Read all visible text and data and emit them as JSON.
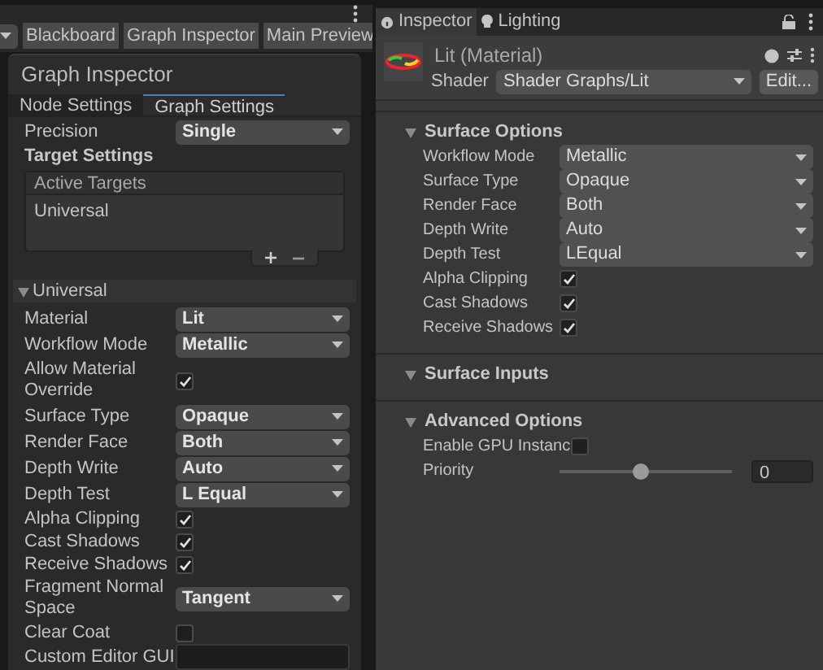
{
  "toolbar": {
    "buttons": [
      "Blackboard",
      "Graph Inspector",
      "Main Preview"
    ]
  },
  "graph_inspector": {
    "title": "Graph Inspector",
    "tabs": [
      {
        "label": "Node Settings",
        "selected": false
      },
      {
        "label": "Graph Settings",
        "selected": true
      }
    ],
    "precision": {
      "label": "Precision",
      "value": "Single"
    },
    "target_settings": "Target Settings",
    "active_targets": {
      "header": "Active Targets",
      "items": [
        "Universal"
      ]
    },
    "universal": {
      "title": "Universal",
      "expanded": true,
      "fields": [
        {
          "kind": "dropdown",
          "label": "Material",
          "value": "Lit"
        },
        {
          "kind": "dropdown",
          "label": "Workflow Mode",
          "value": "Metallic"
        },
        {
          "kind": "checkbox",
          "label": "Allow Material Override",
          "checked": true
        },
        {
          "kind": "dropdown",
          "label": "Surface Type",
          "value": "Opaque"
        },
        {
          "kind": "dropdown",
          "label": "Render Face",
          "value": "Both"
        },
        {
          "kind": "dropdown",
          "label": "Depth Write",
          "value": "Auto"
        },
        {
          "kind": "dropdown",
          "label": "Depth Test",
          "value": "L Equal"
        },
        {
          "kind": "checkbox",
          "label": "Alpha Clipping",
          "checked": true
        },
        {
          "kind": "checkbox",
          "label": "Cast Shadows",
          "checked": true
        },
        {
          "kind": "checkbox",
          "label": "Receive Shadows",
          "checked": true
        },
        {
          "kind": "dropdown",
          "label": "Fragment Normal Space",
          "value": "Tangent"
        },
        {
          "kind": "checkbox",
          "label": "Clear Coat",
          "checked": false
        },
        {
          "kind": "text",
          "label": "Custom Editor GUI"
        }
      ]
    }
  },
  "inspector": {
    "tabs": [
      {
        "label": "Inspector",
        "selected": true
      },
      {
        "label": "Lighting",
        "selected": false
      }
    ],
    "material": {
      "name": "Lit (Material)",
      "shader_label": "Shader",
      "shader": "Shader Graphs/Lit",
      "edit_button": "Edit..."
    },
    "sections": [
      {
        "title": "Surface Options",
        "expanded": true,
        "fields": [
          {
            "kind": "dropdown",
            "label": "Workflow Mode",
            "value": "Metallic"
          },
          {
            "kind": "dropdown",
            "label": "Surface Type",
            "value": "Opaque"
          },
          {
            "kind": "dropdown",
            "label": "Render Face",
            "value": "Both"
          },
          {
            "kind": "dropdown",
            "label": "Depth Write",
            "value": "Auto"
          },
          {
            "kind": "dropdown",
            "label": "Depth Test",
            "value": "LEqual"
          },
          {
            "kind": "checkbox",
            "label": "Alpha Clipping",
            "checked": true
          },
          {
            "kind": "checkbox",
            "label": "Cast Shadows",
            "checked": true
          },
          {
            "kind": "checkbox",
            "label": "Receive Shadows",
            "checked": true
          }
        ]
      },
      {
        "title": "Surface Inputs",
        "expanded": true
      },
      {
        "title": "Advanced Options",
        "expanded": true,
        "fields": [
          {
            "kind": "checkbox",
            "label": "Enable GPU Instanc",
            "checked": false
          },
          {
            "kind": "slider",
            "label": "Priority",
            "level": 0.47,
            "value": "0"
          }
        ]
      }
    ]
  }
}
